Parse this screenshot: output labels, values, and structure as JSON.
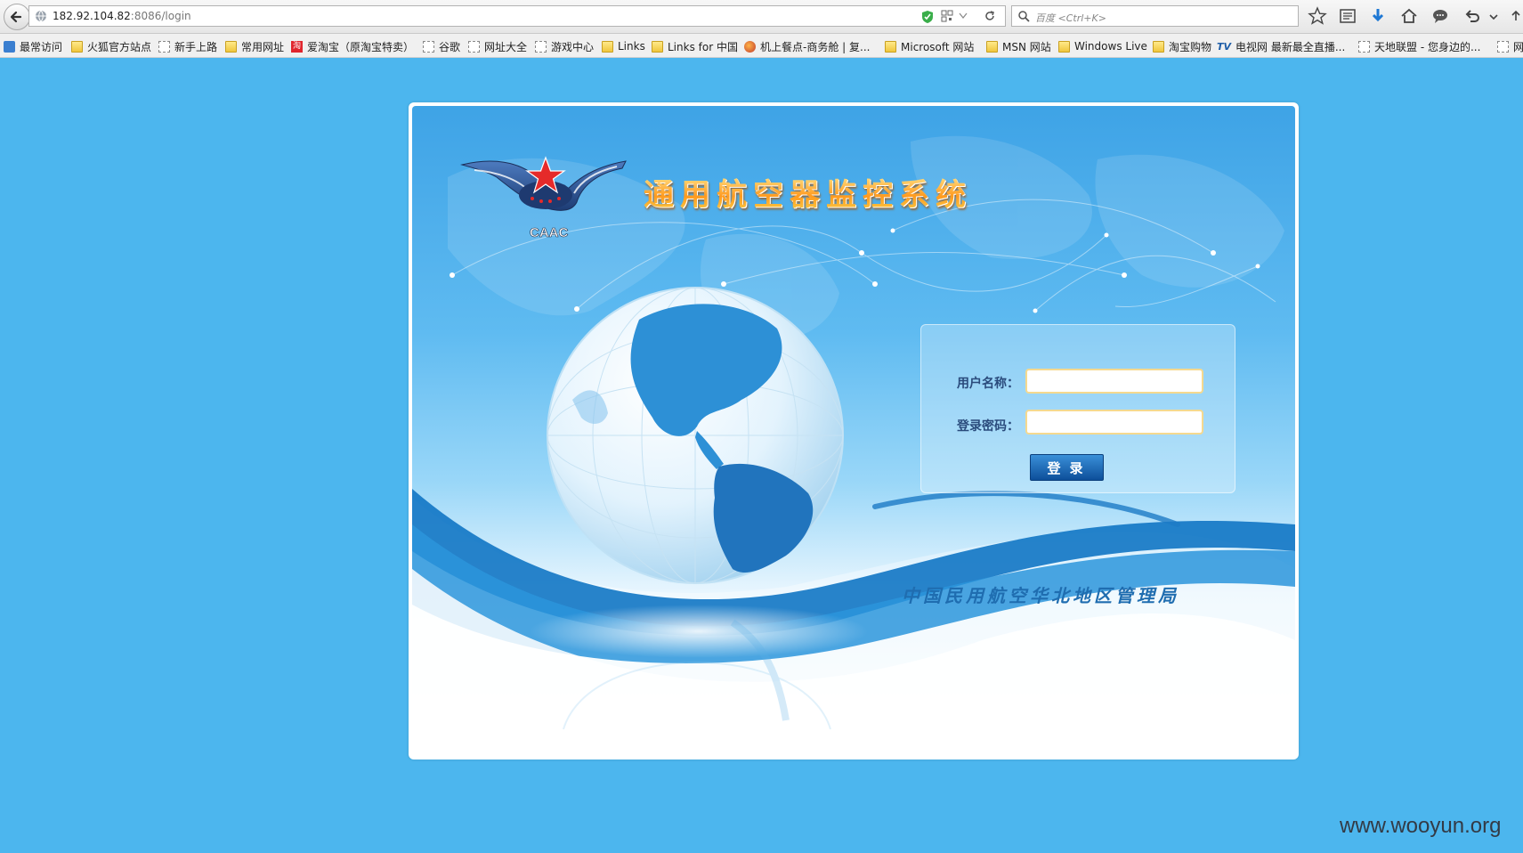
{
  "browser": {
    "url_host": "182.92.104.82",
    "url_path": ":8086/login",
    "search_placeholder": "百度 <Ctrl+K>",
    "bookmarks": [
      {
        "label": "最常访问",
        "icon": "blue"
      },
      {
        "label": "火狐官方站点",
        "icon": "folder"
      },
      {
        "label": "新手上路",
        "icon": "page"
      },
      {
        "label": "常用网址",
        "icon": "folder"
      },
      {
        "label": "爱淘宝（原淘宝特卖）",
        "icon": "red"
      },
      {
        "label": "谷歌",
        "icon": "page"
      },
      {
        "label": "网址大全",
        "icon": "page"
      },
      {
        "label": "游戏中心",
        "icon": "page"
      },
      {
        "label": "Links",
        "icon": "folder"
      },
      {
        "label": "Links for 中国",
        "icon": "folder"
      },
      {
        "label": "机上餐点-商务舱 | 复...",
        "icon": "fox"
      },
      {
        "label": "Microsoft 网站",
        "icon": "folder"
      },
      {
        "label": "MSN 网站",
        "icon": "folder"
      },
      {
        "label": "Windows Live",
        "icon": "folder"
      },
      {
        "label": "淘宝购物",
        "icon": "folder"
      },
      {
        "label": "电视网 最新最全直播...",
        "icon": "tv"
      },
      {
        "label": "天地联盟 - 您身边的...",
        "icon": "page"
      },
      {
        "label": "网",
        "icon": "page"
      }
    ]
  },
  "login_page": {
    "logo_text": "CAAC",
    "system_title": "通用航空器监控系统",
    "username_label": "用户名称：",
    "password_label": "登录密码：",
    "login_button": "登录",
    "organization": "中国民用航空华北地区管理局"
  },
  "watermark": "www.wooyun.org",
  "colors": {
    "page_background": "#4cb6ee",
    "button": "#1a62ad",
    "title_orange": "#ff9a1f",
    "org_text": "#1f6db0"
  }
}
